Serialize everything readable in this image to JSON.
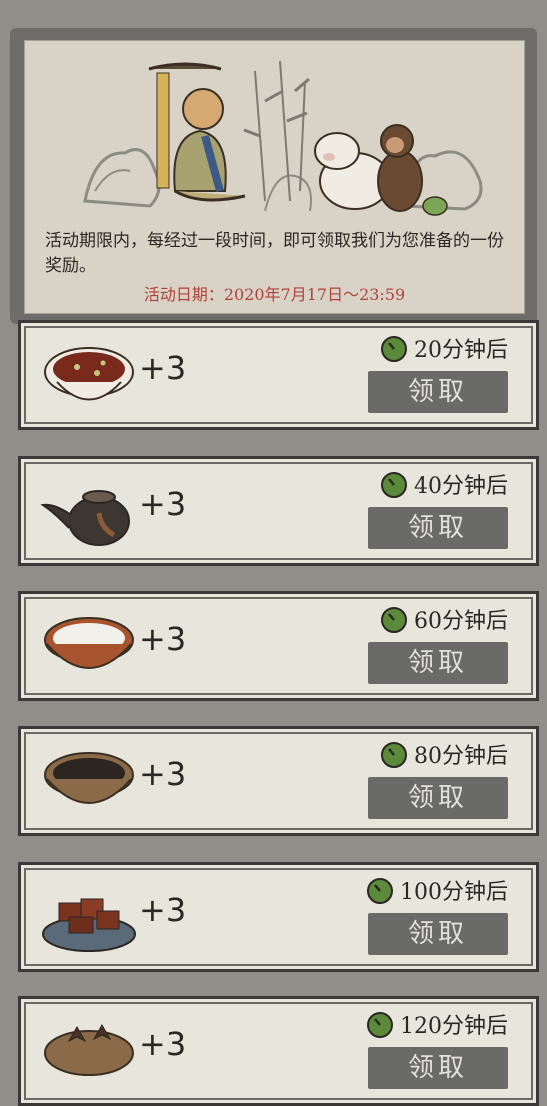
{
  "banner": {
    "description": "活动期限内，每经过一段时间，即可领取我们为您准备的一份奖励。",
    "date": "活动日期：2020年7月17日～23:59"
  },
  "rewards": [
    {
      "food": "bean-bowl-icon",
      "amount": "+3",
      "time": "20分钟后",
      "button": "领取"
    },
    {
      "food": "teapot-icon",
      "amount": "+3",
      "time": "40分钟后",
      "button": "领取"
    },
    {
      "food": "rice-bowl-icon",
      "amount": "+3",
      "time": "60分钟后",
      "button": "领取"
    },
    {
      "food": "dark-bean-bowl-icon",
      "amount": "+3",
      "time": "80分钟后",
      "button": "领取"
    },
    {
      "food": "tofu-plate-icon",
      "amount": "+3",
      "time": "100分钟后",
      "button": "领取"
    },
    {
      "food": "spice-bowl-icon",
      "amount": "+3",
      "time": "120分钟后",
      "button": "领取"
    }
  ],
  "colors": {
    "accent_red": "#b1423b",
    "button_bg": "#6a6a68",
    "card_bg": "#e8e5dc",
    "clock_green": "#5a8a3a"
  }
}
